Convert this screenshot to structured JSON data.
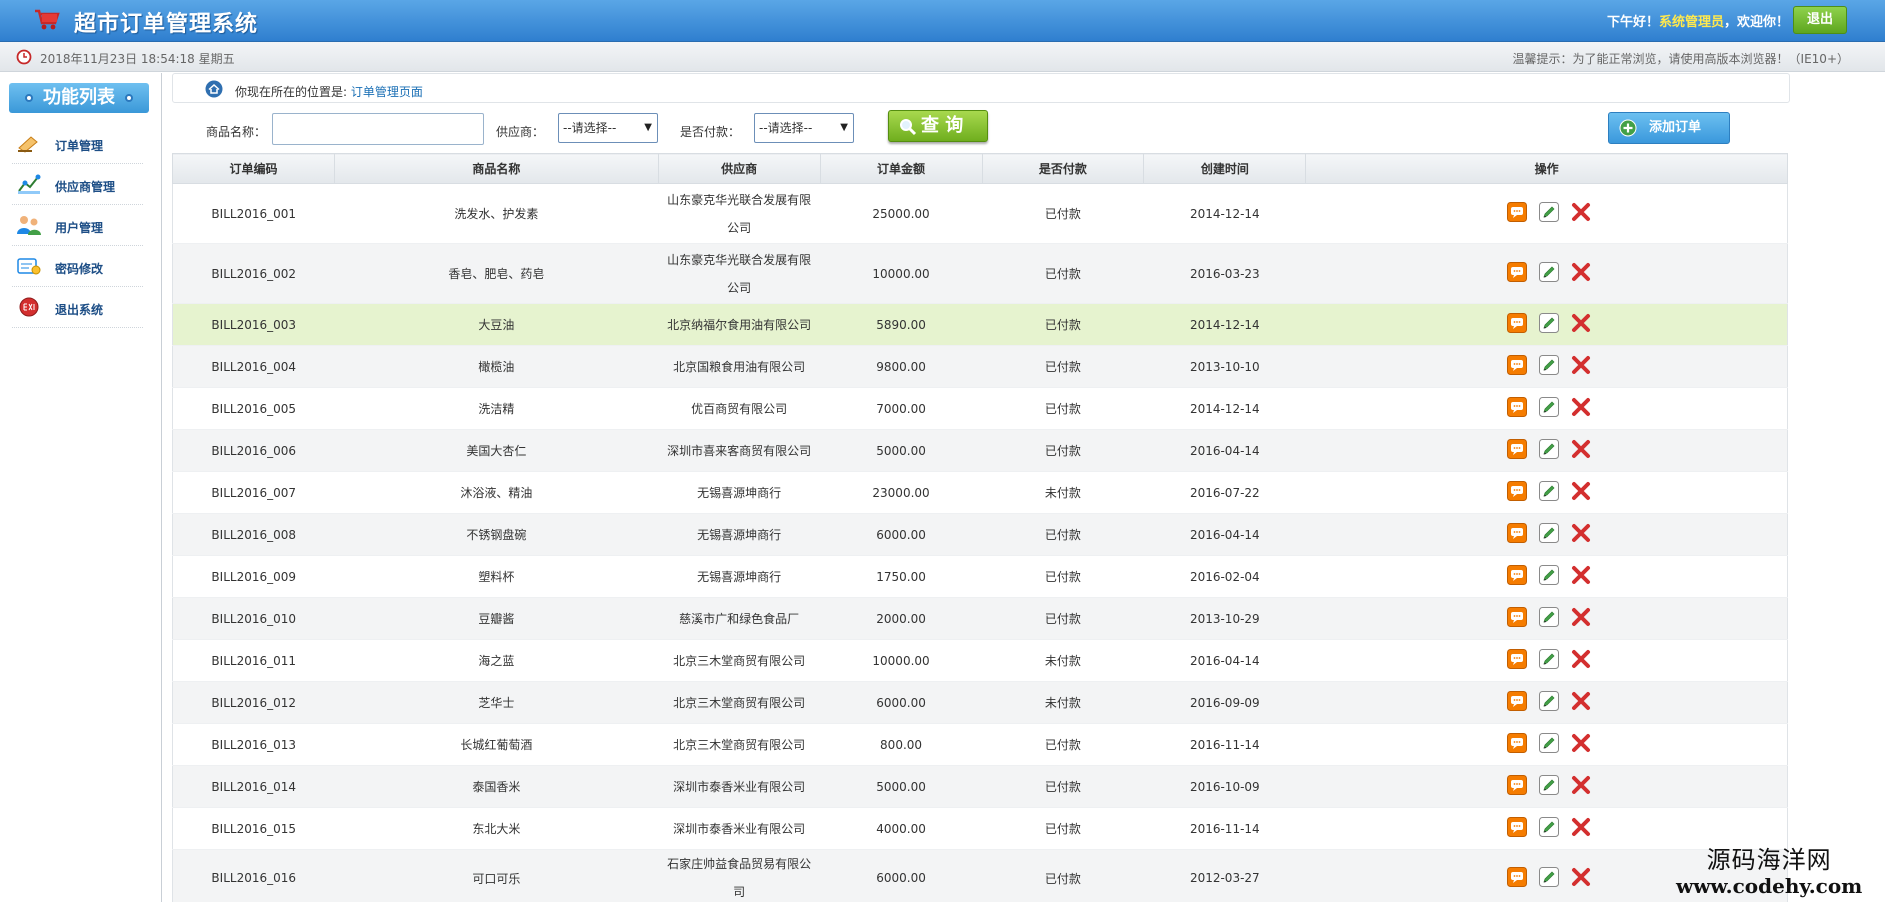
{
  "header": {
    "title": "超市订单管理系统",
    "greeting_prefix": "下午好！",
    "role": "系统管理员",
    "greeting_suffix": "，欢迎你！",
    "logout_label": "退出"
  },
  "subbar": {
    "datetime": "2018年11月23日 18:54:18 星期五",
    "tip": "温馨提示：为了能正常浏览，请使用高版本浏览器！（IE10+）"
  },
  "sidebar": {
    "title": "功能列表",
    "items": [
      {
        "label": "订单管理",
        "icon": "order-icon"
      },
      {
        "label": "供应商管理",
        "icon": "supplier-icon"
      },
      {
        "label": "用户管理",
        "icon": "users-icon"
      },
      {
        "label": "密码修改",
        "icon": "password-icon"
      },
      {
        "label": "退出系统",
        "icon": "exit-icon"
      }
    ]
  },
  "breadcrumb": {
    "prefix": "你现在所在的位置是:",
    "current": "订单管理页面"
  },
  "search": {
    "product_label": "商品名称：",
    "product_value": "",
    "supplier_label": "供应商：",
    "supplier_selected": "--请选择--",
    "paid_label": "是否付款：",
    "paid_selected": "--请选择--",
    "query_label": "查 询",
    "add_label": "添加订单"
  },
  "table": {
    "headers": [
      "订单编码",
      "商品名称",
      "供应商",
      "订单金额",
      "是否付款",
      "创建时间",
      "操作"
    ],
    "rows": [
      {
        "code": "BILL2016_001",
        "name": "洗发水、护发素",
        "supplier": "山东豪克华光联合发展有限公司",
        "amount": "25000.00",
        "paid": "已付款",
        "date": "2014-12-14"
      },
      {
        "code": "BILL2016_002",
        "name": "香皂、肥皂、药皂",
        "supplier": "山东豪克华光联合发展有限公司",
        "amount": "10000.00",
        "paid": "已付款",
        "date": "2016-03-23"
      },
      {
        "code": "BILL2016_003",
        "name": "大豆油",
        "supplier": "北京纳福尔食用油有限公司",
        "amount": "5890.00",
        "paid": "已付款",
        "date": "2014-12-14"
      },
      {
        "code": "BILL2016_004",
        "name": "橄榄油",
        "supplier": "北京国粮食用油有限公司",
        "amount": "9800.00",
        "paid": "已付款",
        "date": "2013-10-10"
      },
      {
        "code": "BILL2016_005",
        "name": "洗洁精",
        "supplier": "优百商贸有限公司",
        "amount": "7000.00",
        "paid": "已付款",
        "date": "2014-12-14"
      },
      {
        "code": "BILL2016_006",
        "name": "美国大杏仁",
        "supplier": "深圳市喜来客商贸有限公司",
        "amount": "5000.00",
        "paid": "已付款",
        "date": "2016-04-14"
      },
      {
        "code": "BILL2016_007",
        "name": "沐浴液、精油",
        "supplier": "无锡喜源坤商行",
        "amount": "23000.00",
        "paid": "未付款",
        "date": "2016-07-22"
      },
      {
        "code": "BILL2016_008",
        "name": "不锈钢盘碗",
        "supplier": "无锡喜源坤商行",
        "amount": "6000.00",
        "paid": "已付款",
        "date": "2016-04-14"
      },
      {
        "code": "BILL2016_009",
        "name": "塑料杯",
        "supplier": "无锡喜源坤商行",
        "amount": "1750.00",
        "paid": "已付款",
        "date": "2016-02-04"
      },
      {
        "code": "BILL2016_010",
        "name": "豆瓣酱",
        "supplier": "慈溪市广和绿色食品厂",
        "amount": "2000.00",
        "paid": "已付款",
        "date": "2013-10-29"
      },
      {
        "code": "BILL2016_011",
        "name": "海之蓝",
        "supplier": "北京三木堂商贸有限公司",
        "amount": "10000.00",
        "paid": "未付款",
        "date": "2016-04-14"
      },
      {
        "code": "BILL2016_012",
        "name": "芝华士",
        "supplier": "北京三木堂商贸有限公司",
        "amount": "6000.00",
        "paid": "未付款",
        "date": "2016-09-09"
      },
      {
        "code": "BILL2016_013",
        "name": "长城红葡萄酒",
        "supplier": "北京三木堂商贸有限公司",
        "amount": "800.00",
        "paid": "已付款",
        "date": "2016-11-14"
      },
      {
        "code": "BILL2016_014",
        "name": "泰国香米",
        "supplier": "深圳市泰香米业有限公司",
        "amount": "5000.00",
        "paid": "已付款",
        "date": "2016-10-09"
      },
      {
        "code": "BILL2016_015",
        "name": "东北大米",
        "supplier": "深圳市泰香米业有限公司",
        "amount": "4000.00",
        "paid": "已付款",
        "date": "2016-11-14"
      },
      {
        "code": "BILL2016_016",
        "name": "可口可乐",
        "supplier": "石家庄帅益食品贸易有限公司",
        "amount": "6000.00",
        "paid": "已付款",
        "date": "2012-03-27"
      }
    ],
    "highlighted_row": 2
  },
  "watermark": {
    "cn": "源码海洋网",
    "en": "www.codehy.com"
  },
  "colors": {
    "header_blue": "#2f7fcf",
    "accent_green": "#6fae1e",
    "highlight_row": "#e6f3cf",
    "role_yellow": "#ffe94d"
  }
}
